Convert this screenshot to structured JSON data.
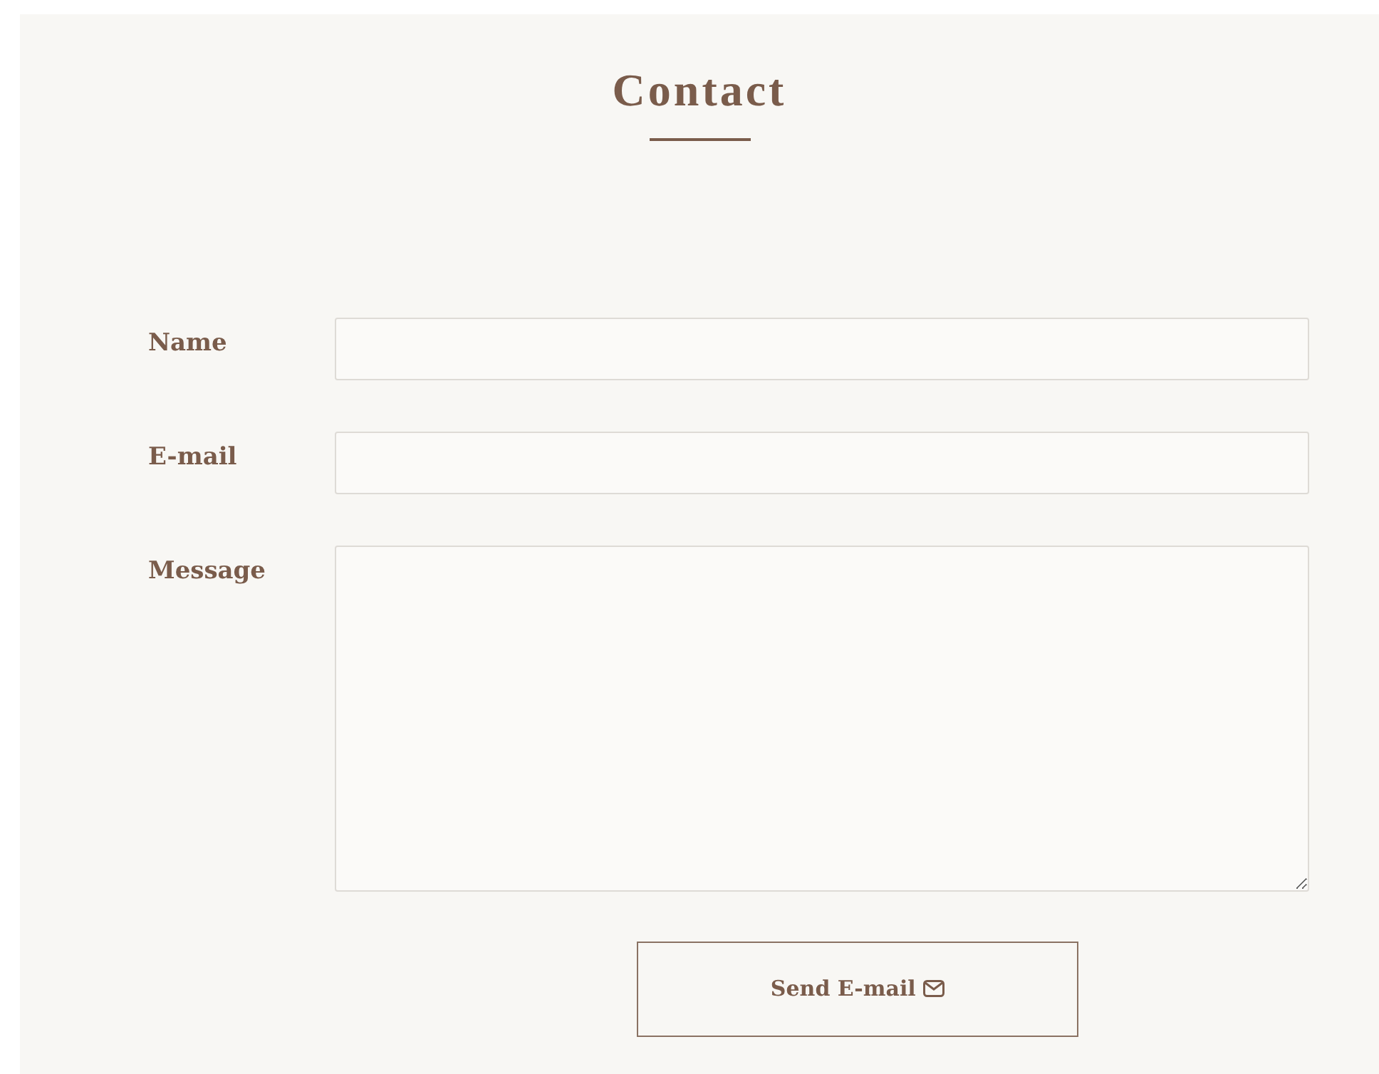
{
  "title": "Contact",
  "fields": [
    {
      "label": "Name",
      "kind": "input"
    },
    {
      "label": "E-mail",
      "kind": "input"
    },
    {
      "label": "Message",
      "kind": "textarea"
    }
  ],
  "button": {
    "label": "Send E-mail"
  }
}
